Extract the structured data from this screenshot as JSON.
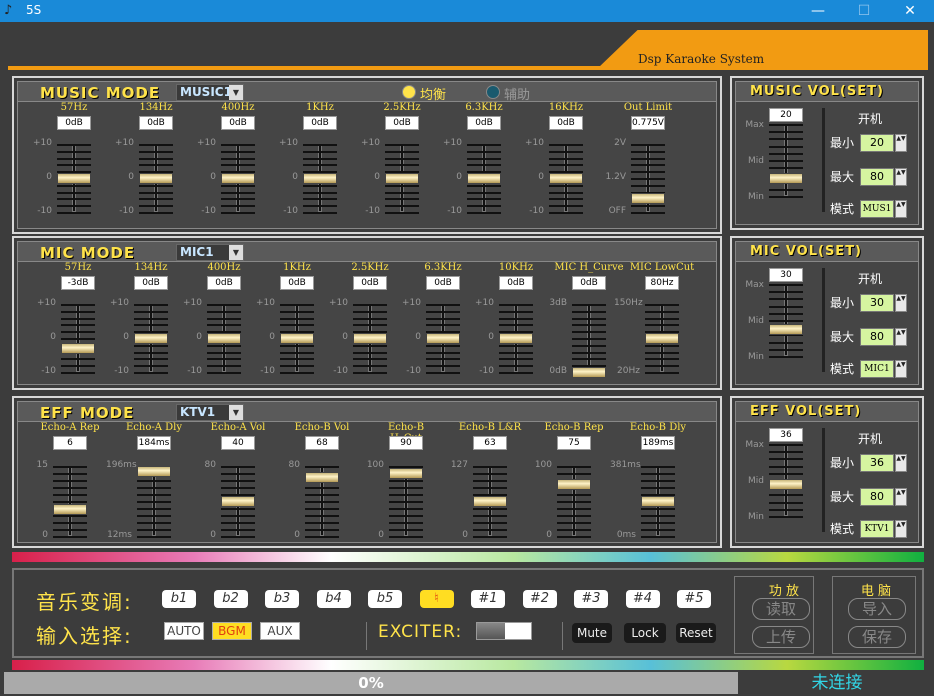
{
  "window": {
    "title": "5S",
    "brand": "Dsp Karaoke System"
  },
  "music": {
    "title": "MUSIC MODE",
    "preset": "MUSIC1",
    "radio": [
      {
        "label": "均衡",
        "selected": true
      },
      {
        "label": "辅助",
        "selected": false
      }
    ],
    "channels": [
      {
        "label": "57Hz",
        "value": "0dB",
        "level": 0.5,
        "scale": [
          "+10",
          "0",
          "-10"
        ]
      },
      {
        "label": "134Hz",
        "value": "0dB",
        "level": 0.5,
        "scale": [
          "+10",
          "0",
          "-10"
        ]
      },
      {
        "label": "400Hz",
        "value": "0dB",
        "level": 0.5,
        "scale": [
          "+10",
          "0",
          "-10"
        ]
      },
      {
        "label": "1KHz",
        "value": "0dB",
        "level": 0.5,
        "scale": [
          "+10",
          "0",
          "-10"
        ]
      },
      {
        "label": "2.5KHz",
        "value": "0dB",
        "level": 0.5,
        "scale": [
          "+10",
          "0",
          "-10"
        ]
      },
      {
        "label": "6.3KHz",
        "value": "0dB",
        "level": 0.5,
        "scale": [
          "+10",
          "0",
          "-10"
        ]
      },
      {
        "label": "16KHz",
        "value": "0dB",
        "level": 0.5,
        "scale": [
          "+10",
          "0",
          "-10"
        ]
      },
      {
        "label": "Out Limit",
        "value": "0.775V",
        "level": 0.2,
        "scale": [
          "2V",
          "1.2V",
          "OFF"
        ]
      }
    ]
  },
  "mic": {
    "title": "MIC MODE",
    "preset": "MIC1",
    "channels": [
      {
        "label": "57Hz",
        "value": "-3dB",
        "level": 0.35,
        "scale": [
          "+10",
          "0",
          "-10"
        ]
      },
      {
        "label": "134Hz",
        "value": "0dB",
        "level": 0.5,
        "scale": [
          "+10",
          "0",
          "-10"
        ]
      },
      {
        "label": "400Hz",
        "value": "0dB",
        "level": 0.5,
        "scale": [
          "+10",
          "0",
          "-10"
        ]
      },
      {
        "label": "1KHz",
        "value": "0dB",
        "level": 0.5,
        "scale": [
          "+10",
          "0",
          "-10"
        ]
      },
      {
        "label": "2.5KHz",
        "value": "0dB",
        "level": 0.5,
        "scale": [
          "+10",
          "0",
          "-10"
        ]
      },
      {
        "label": "6.3KHz",
        "value": "0dB",
        "level": 0.5,
        "scale": [
          "+10",
          "0",
          "-10"
        ]
      },
      {
        "label": "10KHz",
        "value": "0dB",
        "level": 0.5,
        "scale": [
          "+10",
          "0",
          "-10"
        ]
      },
      {
        "label": "MIC H_Curve",
        "value": "0dB",
        "level": 0.0,
        "scale": [
          "3dB",
          "",
          "0dB"
        ]
      },
      {
        "label": "MIC LowCut",
        "value": "80Hz",
        "level": 0.5,
        "scale": [
          "150Hz",
          "",
          "20Hz"
        ]
      }
    ]
  },
  "eff": {
    "title": "EFF MODE",
    "preset": "KTV1",
    "channels": [
      {
        "label": "Echo-A Rep",
        "value": "6",
        "level": 0.38,
        "scale": [
          "15",
          "",
          "0"
        ]
      },
      {
        "label": "Echo-A Dly",
        "value": "184ms",
        "level": 0.93,
        "scale": [
          "196ms",
          "",
          "12ms"
        ]
      },
      {
        "label": "Echo-A Vol",
        "value": "40",
        "level": 0.5,
        "scale": [
          "80",
          "",
          "0"
        ]
      },
      {
        "label": "Echo-B Vol",
        "value": "68",
        "level": 0.85,
        "scale": [
          "80",
          "",
          "0"
        ]
      },
      {
        "label": "Echo-B H_Cut",
        "value": "90",
        "level": 0.9,
        "scale": [
          "100",
          "",
          "0"
        ]
      },
      {
        "label": "Echo-B L&R",
        "value": "63",
        "level": 0.5,
        "scale": [
          "127",
          "",
          "0"
        ]
      },
      {
        "label": "Echo-B Rep",
        "value": "75",
        "level": 0.75,
        "scale": [
          "100",
          "",
          "0"
        ]
      },
      {
        "label": "Echo-B Dly",
        "value": "189ms",
        "level": 0.5,
        "scale": [
          "381ms",
          "",
          "0ms"
        ]
      }
    ]
  },
  "vol": [
    {
      "title": "MUSIC VOL(SET)",
      "value": "20",
      "level": 0.25,
      "scale": [
        "Max",
        "Mid",
        "Min"
      ],
      "boot": "开机",
      "min_label": "最小",
      "min": "20",
      "max_label": "最大",
      "max": "80",
      "mode_label": "模式",
      "mode": "MUS1"
    },
    {
      "title": "MIC VOL(SET)",
      "value": "30",
      "level": 0.37,
      "scale": [
        "Max",
        "Mid",
        "Min"
      ],
      "boot": "开机",
      "min_label": "最小",
      "min": "30",
      "max_label": "最大",
      "max": "80",
      "mode_label": "模式",
      "mode": "MIC1"
    },
    {
      "title": "EFF VOL(SET)",
      "value": "36",
      "level": 0.45,
      "scale": [
        "Max",
        "Mid",
        "Min"
      ],
      "boot": "开机",
      "min_label": "最小",
      "min": "36",
      "max_label": "最大",
      "max": "80",
      "mode_label": "模式",
      "mode": "KTV1"
    }
  ],
  "bottom": {
    "key_label": "音乐变调:",
    "keys": [
      "b1",
      "b2",
      "b3",
      "b4",
      "b5",
      "♮",
      "#1",
      "#2",
      "#3",
      "#4",
      "#5"
    ],
    "active_key": 5,
    "input_label": "输入选择:",
    "inputs": [
      "AUTO",
      "BGM",
      "AUX"
    ],
    "active_input": 1,
    "exciter_label": "EXCITER:",
    "mute": "Mute",
    "lock": "Lock",
    "reset": "Reset",
    "amp_title": "功 放",
    "amp_read": "读取",
    "amp_upload": "上传",
    "pc_title": "电 脑",
    "pc_import": "导入",
    "pc_save": "保存"
  },
  "status": {
    "progress": "0%",
    "connection": "未连接"
  },
  "colors": {
    "accent": "#f29b12",
    "label": "#ffe34a",
    "titlebar": "#1a8ad8",
    "connection": "#32d6e6"
  }
}
